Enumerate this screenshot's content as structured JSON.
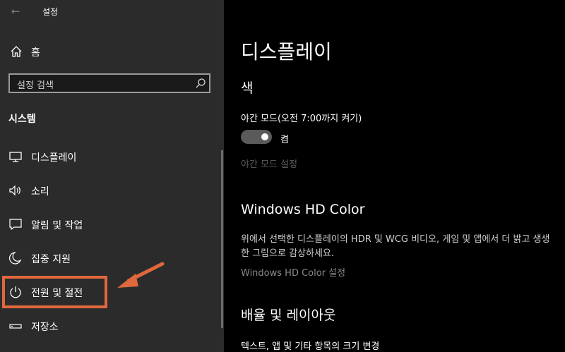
{
  "window": {
    "title": "설정"
  },
  "sidebar": {
    "home_label": "홈",
    "search_placeholder": "설정 검색",
    "section_title": "시스템",
    "items": [
      {
        "label": "디스플레이",
        "icon": "monitor-icon"
      },
      {
        "label": "소리",
        "icon": "speaker-icon"
      },
      {
        "label": "알림 및 작업",
        "icon": "message-icon"
      },
      {
        "label": "집중 지원",
        "icon": "moon-icon"
      },
      {
        "label": "전원 및 절전",
        "icon": "power-icon"
      },
      {
        "label": "저장소",
        "icon": "storage-icon"
      }
    ]
  },
  "main": {
    "title": "디스플레이",
    "color_section": "색",
    "night_mode_label": "야간 모드(오전 7:00까지 켜기)",
    "toggle_state": "켬",
    "night_mode_settings": "야간 모드 설정",
    "hd_color_title": "Windows HD Color",
    "hd_color_desc": "위에서 선택한 디스플레이의 HDR 및 WCG 비디오, 게임 및 앱에서 더 밝고 생생한 그림으로 감상하세요.",
    "hd_color_settings": "Windows HD Color 설정",
    "scale_layout_title": "배율 및 레이아웃",
    "text_size_label": "텍스트, 앱 및 기타 항목의 크기 변경"
  },
  "colors": {
    "sidebar_bg": "#2b2b2b",
    "main_bg": "#000000",
    "annotation": "#e0683c"
  }
}
